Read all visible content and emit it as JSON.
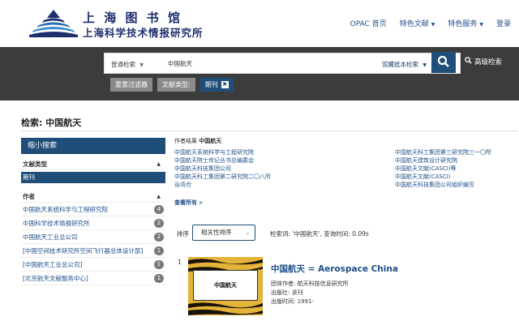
{
  "header": {
    "logo_line1": "上 海 图 书 馆",
    "logo_line2": "上海科学技术情报研究所",
    "nav": [
      {
        "label": "OPAC 首页",
        "caret": false
      },
      {
        "label": "特色文献",
        "caret": true
      },
      {
        "label": "特色服务",
        "caret": true
      },
      {
        "label": "登录",
        "caret": false
      }
    ]
  },
  "search": {
    "scope_label": "普通检索",
    "query": "中国航天",
    "library_label": "馆藏纸本检索",
    "advanced_label": "高级检索",
    "filters": {
      "reset_label": "重置过滤器",
      "type_label": "文献类型:",
      "selected_label": "期刊",
      "remove_glyph": "✖"
    }
  },
  "page": {
    "title": "检索: 中国航天"
  },
  "sidebar": {
    "header": "缩小搜索",
    "facets": [
      {
        "title": "文献类型",
        "selected": "期刊",
        "items": []
      },
      {
        "title": "作者",
        "selected": null,
        "items": [
          {
            "label": "中国航天系统科学与工程研究院",
            "count": "4"
          },
          {
            "label": "中国科学技术情报研究所",
            "count": "2"
          },
          {
            "label": "中国航天工业总公司",
            "count": "2"
          },
          {
            "label": "[中国空间技术研究所空间飞行器总体设计部]",
            "count": "1"
          },
          {
            "label": "[中国航天工业总公司]",
            "count": "1"
          },
          {
            "label": "[北京航天文献服务中心]",
            "count": "1"
          }
        ]
      }
    ]
  },
  "authors": {
    "heading_prefix": "作者结果",
    "heading_term": "中国航天",
    "col1": [
      "中国航天系统科学与工程研究院",
      "中国航天院士传记丛书总编委会",
      "中国航天科技集团公司",
      "中国航天科工集团第二研究院二〇八所",
      "谷湾仓"
    ],
    "col2": [
      "中国航天科工集团第三研究院三一〇所",
      "中国航天建筑设计研究院",
      "中国航天文献(CASCI)等",
      "中国航天文献(CASCI)",
      "中国航天科技集团公司组织编写"
    ],
    "see_all": "查看所有 »"
  },
  "sort": {
    "label": "排序",
    "selected": "相关性排序",
    "info": "检索词: '中国航天', 查询时间: 0.09s"
  },
  "results": [
    {
      "number": "1",
      "cover_text": "中国航天",
      "title": "中国航天 = Aerospace China",
      "meta": [
        "团体作者: 航天科技信息研究所",
        "出版社: 该刊",
        "出版时间: 1991-"
      ]
    }
  ]
}
